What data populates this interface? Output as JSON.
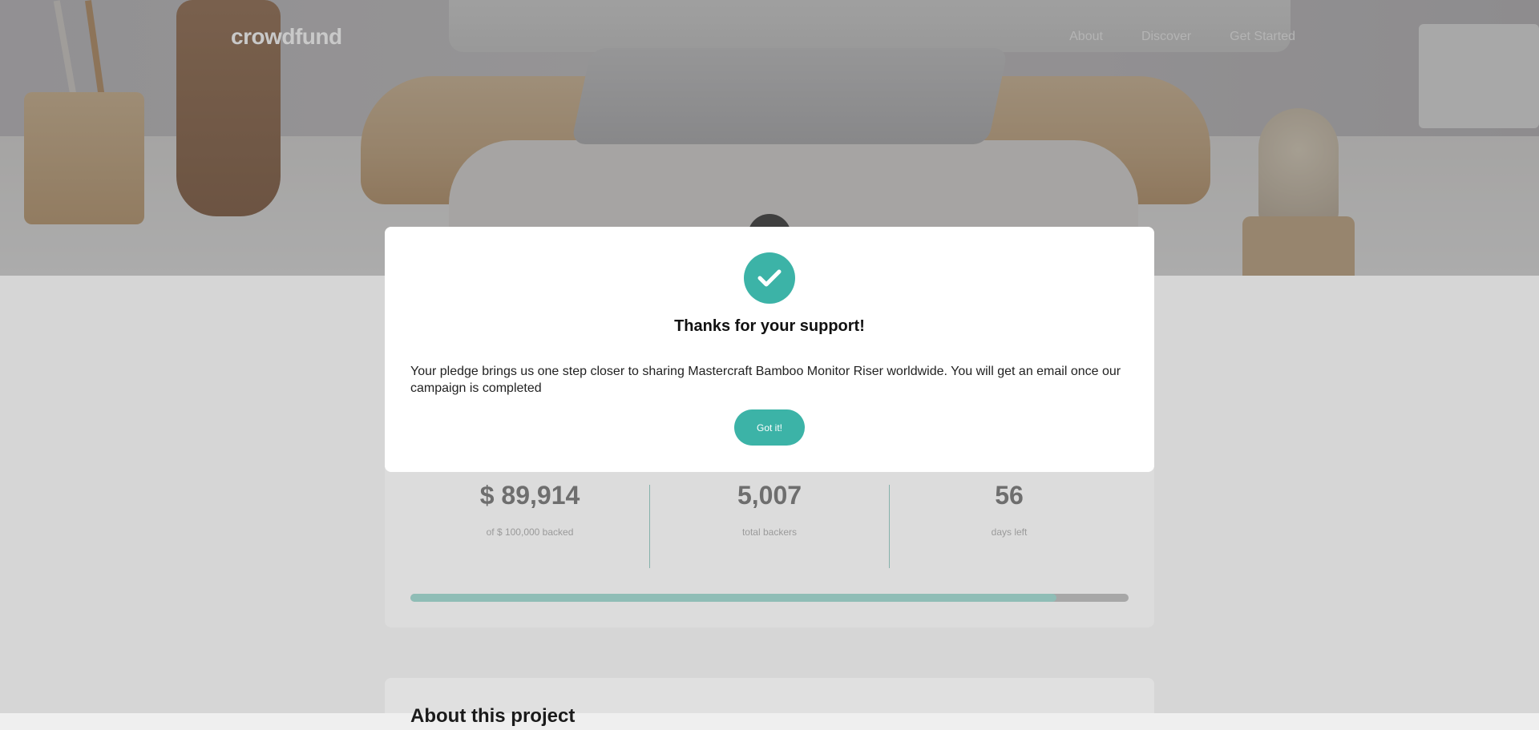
{
  "header": {
    "logo": "crowdfund",
    "nav": [
      {
        "label": "About"
      },
      {
        "label": "Discover"
      },
      {
        "label": "Get Started"
      }
    ]
  },
  "modal": {
    "icon": "check-icon",
    "title": "Thanks for your support!",
    "message": "Your pledge brings us one step closer to sharing Mastercraft Bamboo Monitor Riser worldwide. You will get an email once our campaign is completed",
    "button_label": "Got it!"
  },
  "stats": [
    {
      "value": "$ 89,914",
      "label": "of $ 100,000 backed"
    },
    {
      "value": "5,007",
      "label": "total backers"
    },
    {
      "value": "56",
      "label": "days left"
    }
  ],
  "progress": {
    "fraction": 0.899
  },
  "about": {
    "title": "About this project"
  },
  "colors": {
    "accent": "#3cb3a7"
  }
}
